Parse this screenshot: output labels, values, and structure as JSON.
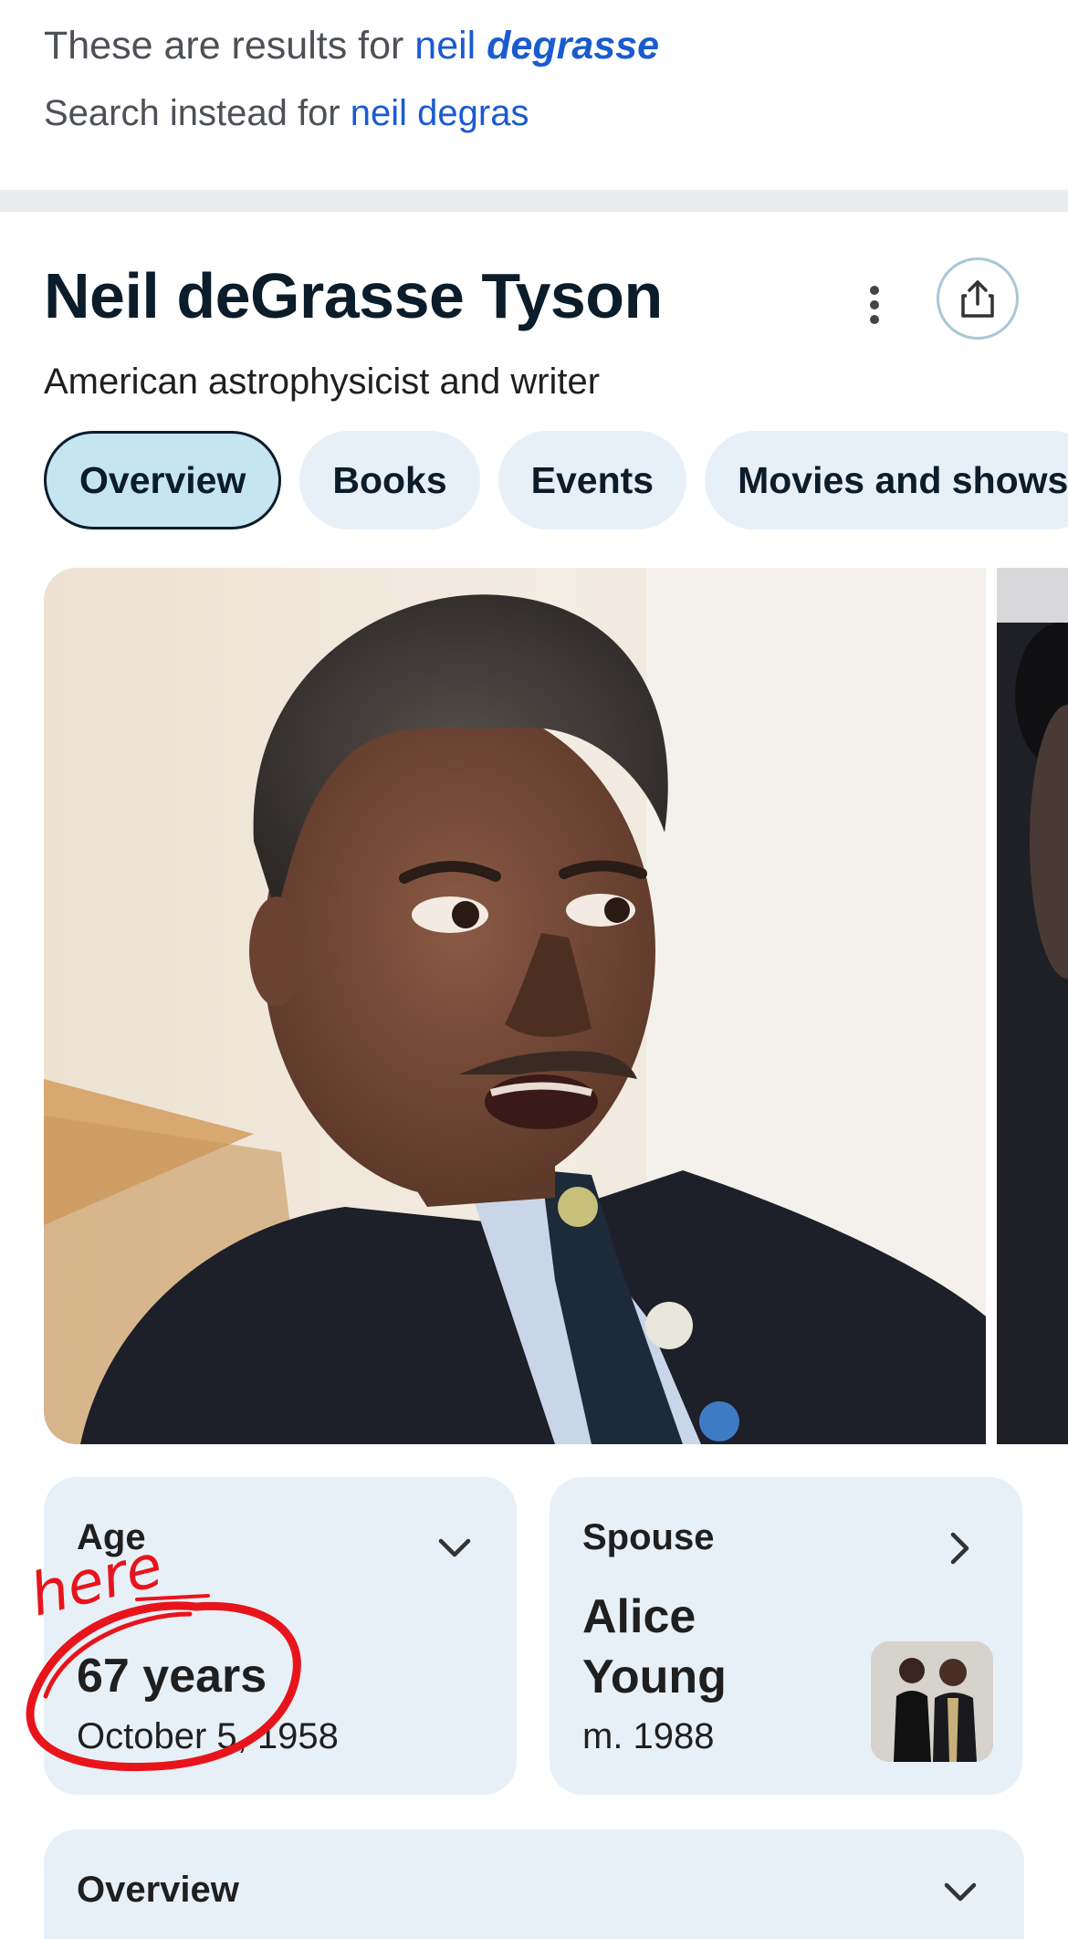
{
  "correction": {
    "results_prefix": "These are results for",
    "results_term_plain": "neil",
    "results_term_emph": "degrasse",
    "instead_prefix": "Search instead for",
    "instead_term": "neil degras"
  },
  "entity": {
    "name": "Neil deGrasse Tyson",
    "description": "American astrophysicist and writer"
  },
  "tabs": [
    {
      "label": "Overview",
      "active": true
    },
    {
      "label": "Books",
      "active": false
    },
    {
      "label": "Events",
      "active": false
    },
    {
      "label": "Movies and shows",
      "active": false
    }
  ],
  "facts": {
    "age": {
      "label": "Age",
      "value": "67 years",
      "date": "October 5, 1958"
    },
    "spouse": {
      "label": "Spouse",
      "name": "Alice Young",
      "married": "m. 1988"
    }
  },
  "overview_section": {
    "label": "Overview"
  },
  "annotation": {
    "text": "here"
  },
  "colors": {
    "link": "#1a5bd1",
    "chip_bg": "#e8f0f7",
    "chip_active_bg": "#c5e6f1",
    "annotation_red": "#e8141c"
  },
  "icons": {
    "more": "more-vert-icon",
    "share": "share-icon",
    "age_expand": "chevron-down-icon",
    "spouse_open": "chevron-right-icon",
    "overview_expand": "chevron-down-icon"
  }
}
